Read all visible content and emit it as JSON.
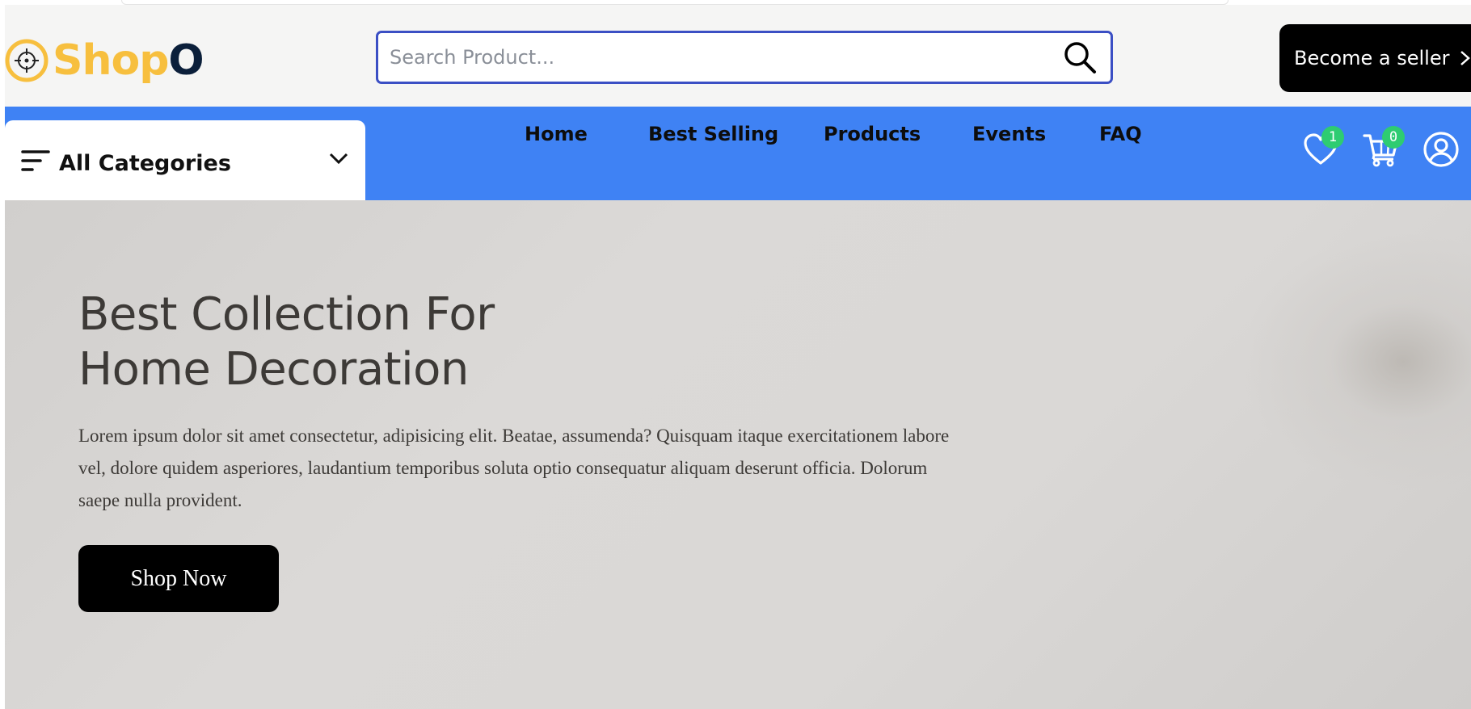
{
  "header": {
    "logo": {
      "text_primary": "Shop",
      "text_secondary": "O",
      "icon": "crosshair-logo-icon",
      "primary_color": "#f7bf3e",
      "secondary_color": "#0b1f3a"
    },
    "search": {
      "placeholder": "Search Product...",
      "icon": "search-icon"
    },
    "seller_button": {
      "label": "Become a seller",
      "icon": "chevron-right-icon"
    }
  },
  "navbar": {
    "background_color": "#3f82f4",
    "category_dropdown": {
      "label": "All Categories",
      "icon": "menu-icon",
      "expand_icon": "chevron-down-icon"
    },
    "links": [
      "Home",
      "Best Selling",
      "Products",
      "Events",
      "FAQ"
    ],
    "icons": {
      "wishlist": {
        "icon": "heart-icon",
        "count": "1"
      },
      "cart": {
        "icon": "cart-icon",
        "count": "0"
      },
      "profile": {
        "icon": "user-profile-icon"
      }
    },
    "badge_color": "#2ecc71"
  },
  "hero": {
    "title_line1": "Best Collection For",
    "title_line2": "Home Decoration",
    "description": "Lorem ipsum dolor sit amet consectetur, adipisicing elit. Beatae, assumenda? Quisquam itaque exercitationem labore vel, dolore quidem asperiores, laudantium temporibus soluta optio consequatur aliquam deserunt officia. Dolorum saepe nulla provident.",
    "cta_label": "Shop Now"
  }
}
